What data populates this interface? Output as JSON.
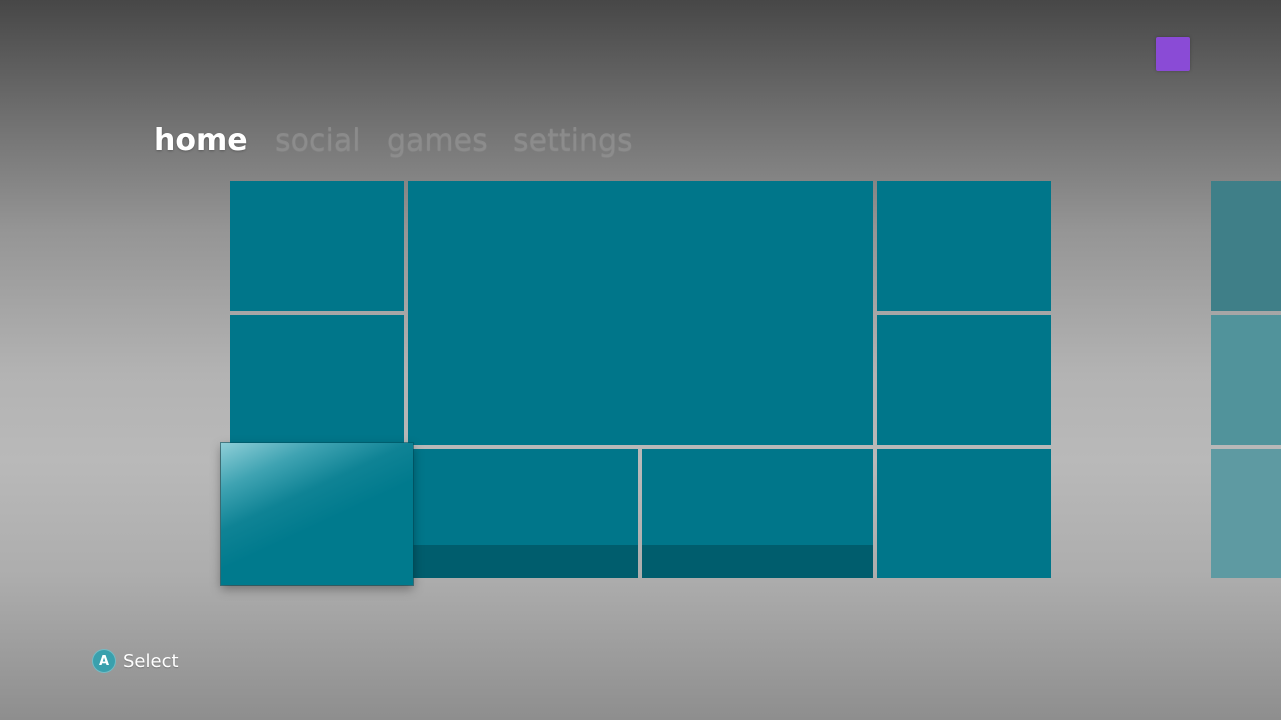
{
  "header": {
    "avatar": {
      "color": "#8a4bd6",
      "icon": "user-avatar"
    }
  },
  "nav": {
    "tabs": [
      {
        "label": "home",
        "active": true
      },
      {
        "label": "social",
        "active": false
      },
      {
        "label": "games",
        "active": false
      },
      {
        "label": "settings",
        "active": false
      }
    ]
  },
  "tiles": {
    "accent_color": "#00768a",
    "band_color": "#005d6d",
    "focused_tile": "tile-bottom-left"
  },
  "footer": {
    "button_glyph": "A",
    "button_color": "#3aa0ad",
    "action_label": "Select"
  }
}
